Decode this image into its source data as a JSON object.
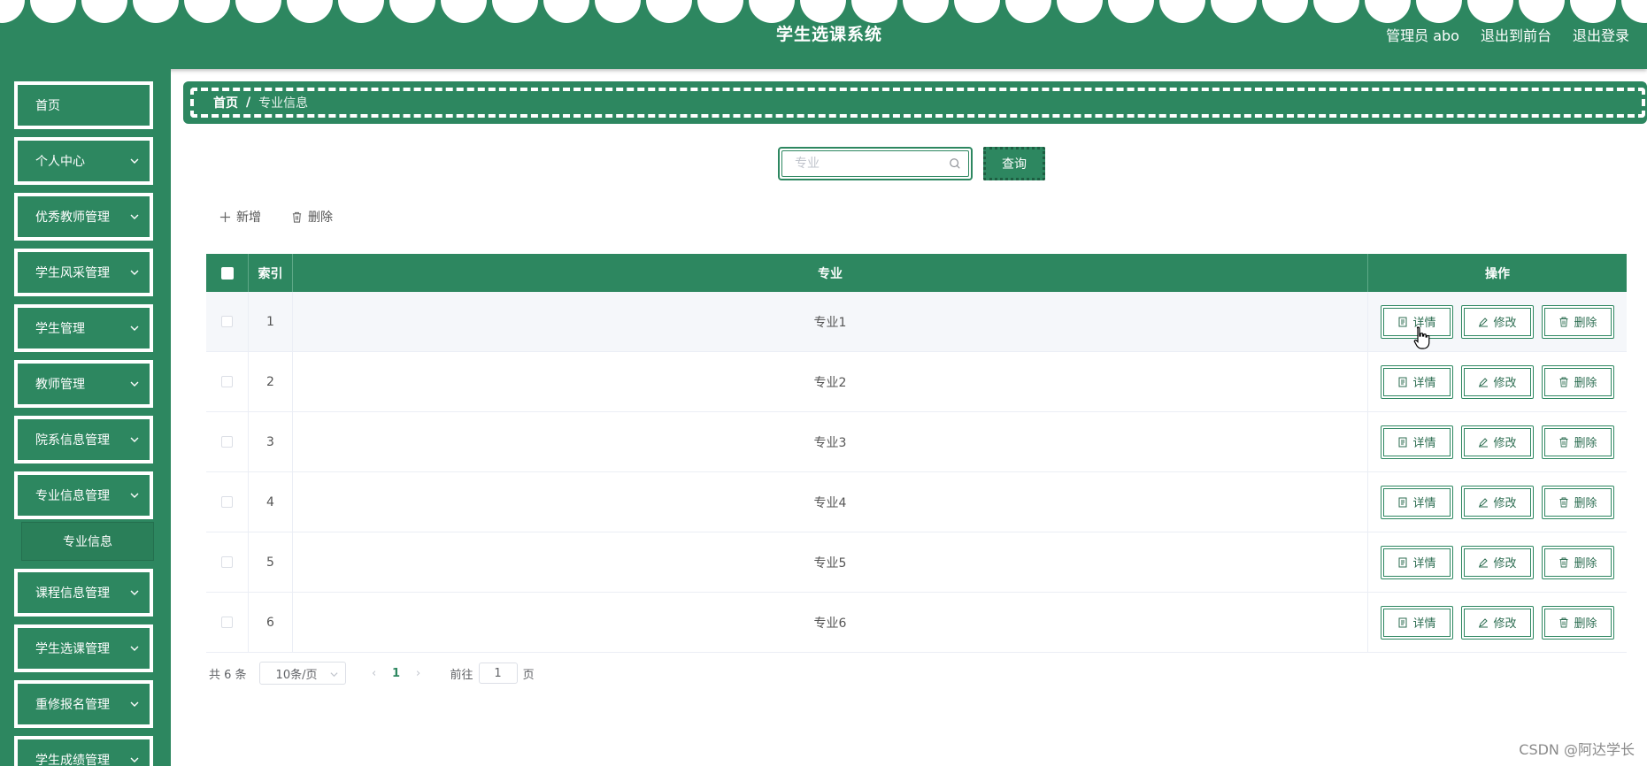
{
  "header": {
    "title": "学生选课系统",
    "user_label": "管理员 abo",
    "front_label": "退出到前台",
    "logout_label": "退出登录"
  },
  "sidebar": {
    "items": [
      {
        "label": "首页",
        "expandable": false
      },
      {
        "label": "个人中心",
        "expandable": true
      },
      {
        "label": "优秀教师管理",
        "expandable": true
      },
      {
        "label": "学生风采管理",
        "expandable": true
      },
      {
        "label": "学生管理",
        "expandable": true
      },
      {
        "label": "教师管理",
        "expandable": true
      },
      {
        "label": "院系信息管理",
        "expandable": true
      },
      {
        "label": "专业信息管理",
        "expandable": true
      },
      {
        "label": "课程信息管理",
        "expandable": true
      },
      {
        "label": "学生选课管理",
        "expandable": true
      },
      {
        "label": "重修报名管理",
        "expandable": true
      },
      {
        "label": "学生成绩管理",
        "expandable": true
      }
    ],
    "submenu": {
      "label": "专业信息"
    }
  },
  "breadcrumb": {
    "home": "首页",
    "separator": "/",
    "current": "专业信息"
  },
  "search": {
    "placeholder": "专业",
    "value": "",
    "button": "查询"
  },
  "toolbar": {
    "add": "新增",
    "delete": "删除"
  },
  "table": {
    "columns": {
      "index": "索引",
      "major": "专业",
      "ops": "操作"
    },
    "rows": [
      {
        "index": "1",
        "major": "专业1"
      },
      {
        "index": "2",
        "major": "专业2"
      },
      {
        "index": "3",
        "major": "专业3"
      },
      {
        "index": "4",
        "major": "专业4"
      },
      {
        "index": "5",
        "major": "专业5"
      },
      {
        "index": "6",
        "major": "专业6"
      }
    ],
    "actions": {
      "detail": "详情",
      "edit": "修改",
      "delete": "删除"
    }
  },
  "pagination": {
    "total": "共 6 条",
    "page_size": "10条/页",
    "prev": "‹",
    "next": "›",
    "current_page": "1",
    "goto_prefix": "前往",
    "goto_value": "1",
    "goto_suffix": "页"
  },
  "watermark": "CSDN @阿达学长",
  "colors": {
    "primary": "#2d8760",
    "header_bg": "#2d8760",
    "sidebar_bg": "#2d8760"
  }
}
